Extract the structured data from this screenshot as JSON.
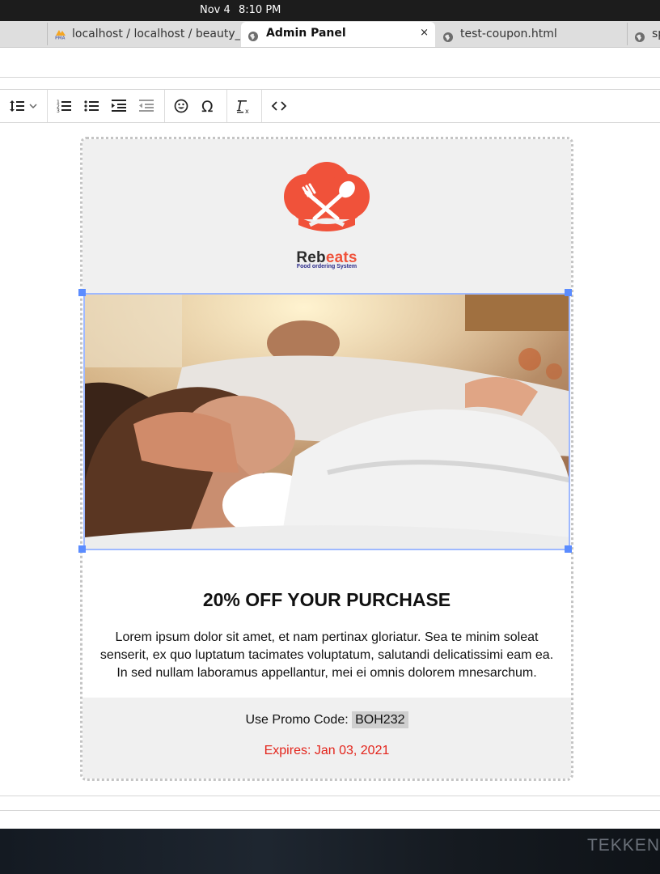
{
  "system": {
    "date": "Nov 4",
    "time": "8:10 PM"
  },
  "tabs": [
    {
      "label": "",
      "icon": "tab-icon",
      "active": false
    },
    {
      "label": "localhost / localhost / beauty_",
      "icon": "phpmyadmin-icon",
      "active": false
    },
    {
      "label": "Admin Panel",
      "icon": "globe-icon",
      "active": true,
      "close": "×"
    },
    {
      "label": "test-coupon.html",
      "icon": "globe-icon",
      "active": false
    },
    {
      "label": "sp",
      "icon": "globe-icon",
      "active": false
    }
  ],
  "toolbar": {
    "buttons": [
      {
        "name": "line-height-button",
        "icon": "line-height-icon"
      },
      {
        "name": "numbered-list-button",
        "icon": "numbered-list-icon"
      },
      {
        "name": "bulleted-list-button",
        "icon": "bulleted-list-icon"
      },
      {
        "name": "indent-button",
        "icon": "indent-icon"
      },
      {
        "name": "outdent-button",
        "icon": "outdent-icon"
      },
      {
        "name": "emoji-button",
        "icon": "emoji-icon"
      },
      {
        "name": "special-character-button",
        "icon": "omega-icon"
      },
      {
        "name": "clear-formatting-button",
        "icon": "clear-formatting-icon"
      },
      {
        "name": "source-code-button",
        "icon": "code-icon"
      }
    ]
  },
  "coupon": {
    "brand_part1": "Reb",
    "brand_part2": "eats",
    "tagline": "Food ordering System",
    "headline": "20% OFF YOUR PURCHASE",
    "body": "Lorem ipsum dolor sit amet, et nam pertinax gloriatur. Sea te minim soleat senserit, ex quo luptatum tacimates voluptatum, salutandi delicatissimi eam ea. In sed nullam laboramus appellantur, mei ei omnis dolorem mnesarchum.",
    "promo_label": "Use Promo Code:",
    "promo_code": "BOH232",
    "expires": "Expires: Jan 03, 2021"
  },
  "colors": {
    "brand_accent": "#f0523a",
    "expires_text": "#e3241b",
    "selection_handle": "#5b8cff"
  },
  "footer": {
    "brand": "TEKKEN"
  }
}
